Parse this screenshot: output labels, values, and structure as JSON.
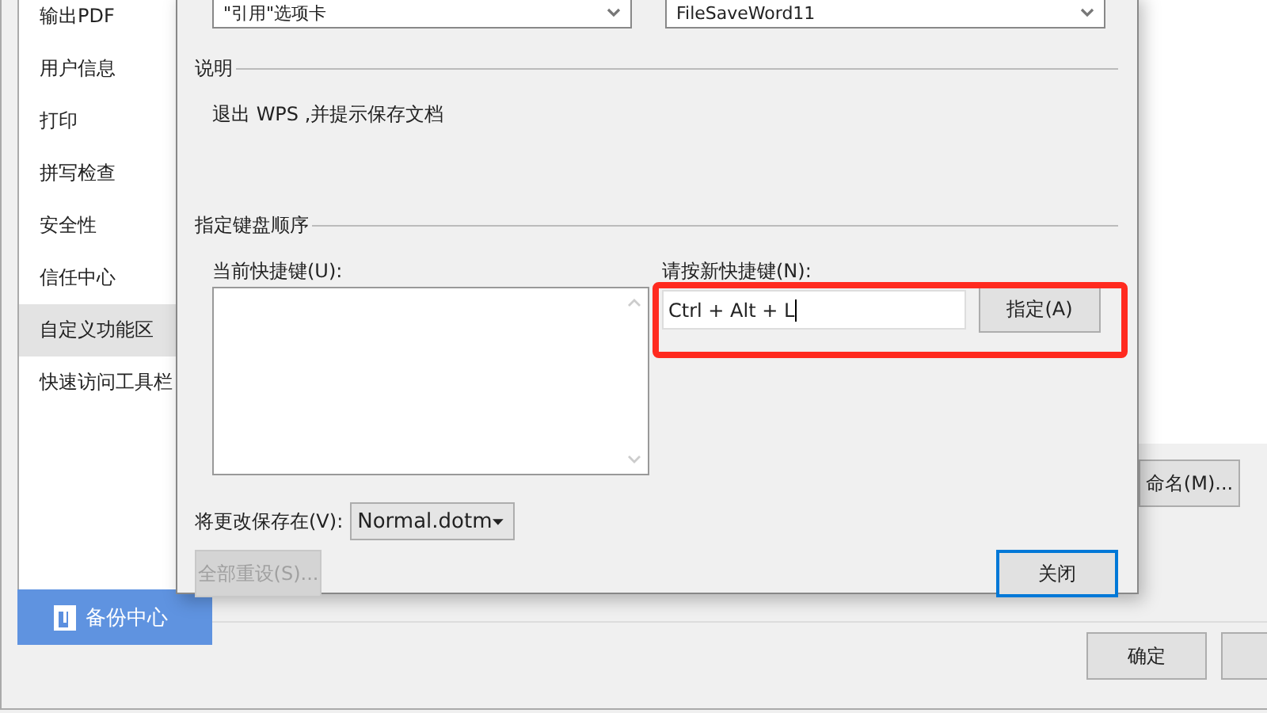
{
  "background_window": {
    "sidebar": {
      "items": [
        {
          "label": "输出PDF",
          "selected": false
        },
        {
          "label": "用户信息",
          "selected": false
        },
        {
          "label": "打印",
          "selected": false
        },
        {
          "label": "拼写检查",
          "selected": false
        },
        {
          "label": "安全性",
          "selected": false
        },
        {
          "label": "信任中心",
          "selected": false
        },
        {
          "label": "自定义功能区",
          "selected": true
        },
        {
          "label": "快速访问工具栏",
          "selected": false
        }
      ]
    },
    "backup_button": "备份中心",
    "rename_button": "命名(M)...",
    "ok_button": "确定"
  },
  "dialog": {
    "top_lists": [
      {
        "value": "\"引用\"选项卡"
      },
      {
        "value": "FileSaveWord11"
      }
    ],
    "description_heading": "说明",
    "description": "退出 WPS ,并提示保存文档",
    "keyboard_heading": "指定键盘顺序",
    "current_keys_label": "当前快捷键(U):",
    "new_key_label": "请按新快捷键(N):",
    "new_key_value": "Ctrl + Alt + L",
    "assign_button": "指定(A)",
    "save_in_label": "将更改保存在(V):",
    "save_in_value": "Normal.dotm",
    "reset_all_button": {
      "label": "全部重设(S)...",
      "disabled": true
    },
    "close_button": {
      "label": "关闭",
      "focused": true
    }
  }
}
